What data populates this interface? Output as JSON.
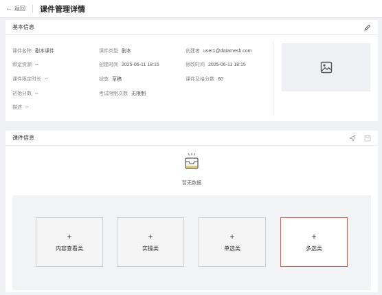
{
  "topbar": {
    "back_label": "返回",
    "title": "课件管理详情"
  },
  "basic": {
    "heading": "基本信息",
    "fields": [
      {
        "label": "课件名称",
        "value": "剧本课件"
      },
      {
        "label": "绑定资源",
        "value": "--"
      },
      {
        "label": "课件限定时长",
        "value": "--"
      },
      {
        "label": "初始分数",
        "value": "--"
      },
      {
        "label": "描述",
        "value": "--"
      },
      {
        "label": "课件类型",
        "value": "剧本"
      },
      {
        "label": "创建时间",
        "value": "2025-06-11 18:15"
      },
      {
        "label": "状态",
        "value": "草稿"
      },
      {
        "label": "考试限制次数",
        "value": "无限制"
      },
      {
        "label": "创建者",
        "value": "user1@datamesh.com"
      },
      {
        "label": "修改时间",
        "value": "2025-06-11 18:15"
      },
      {
        "label": "课件及格分数",
        "value": "60"
      }
    ]
  },
  "courseware": {
    "heading": "课件信息",
    "empty_text": "暂无数据",
    "tiles": [
      {
        "plus": "+",
        "label": "内容查看类"
      },
      {
        "plus": "+",
        "label": "实操类"
      },
      {
        "plus": "+",
        "label": "单选类"
      },
      {
        "plus": "+",
        "label": "多选类"
      }
    ],
    "active_tile_border": "#e05a45"
  }
}
